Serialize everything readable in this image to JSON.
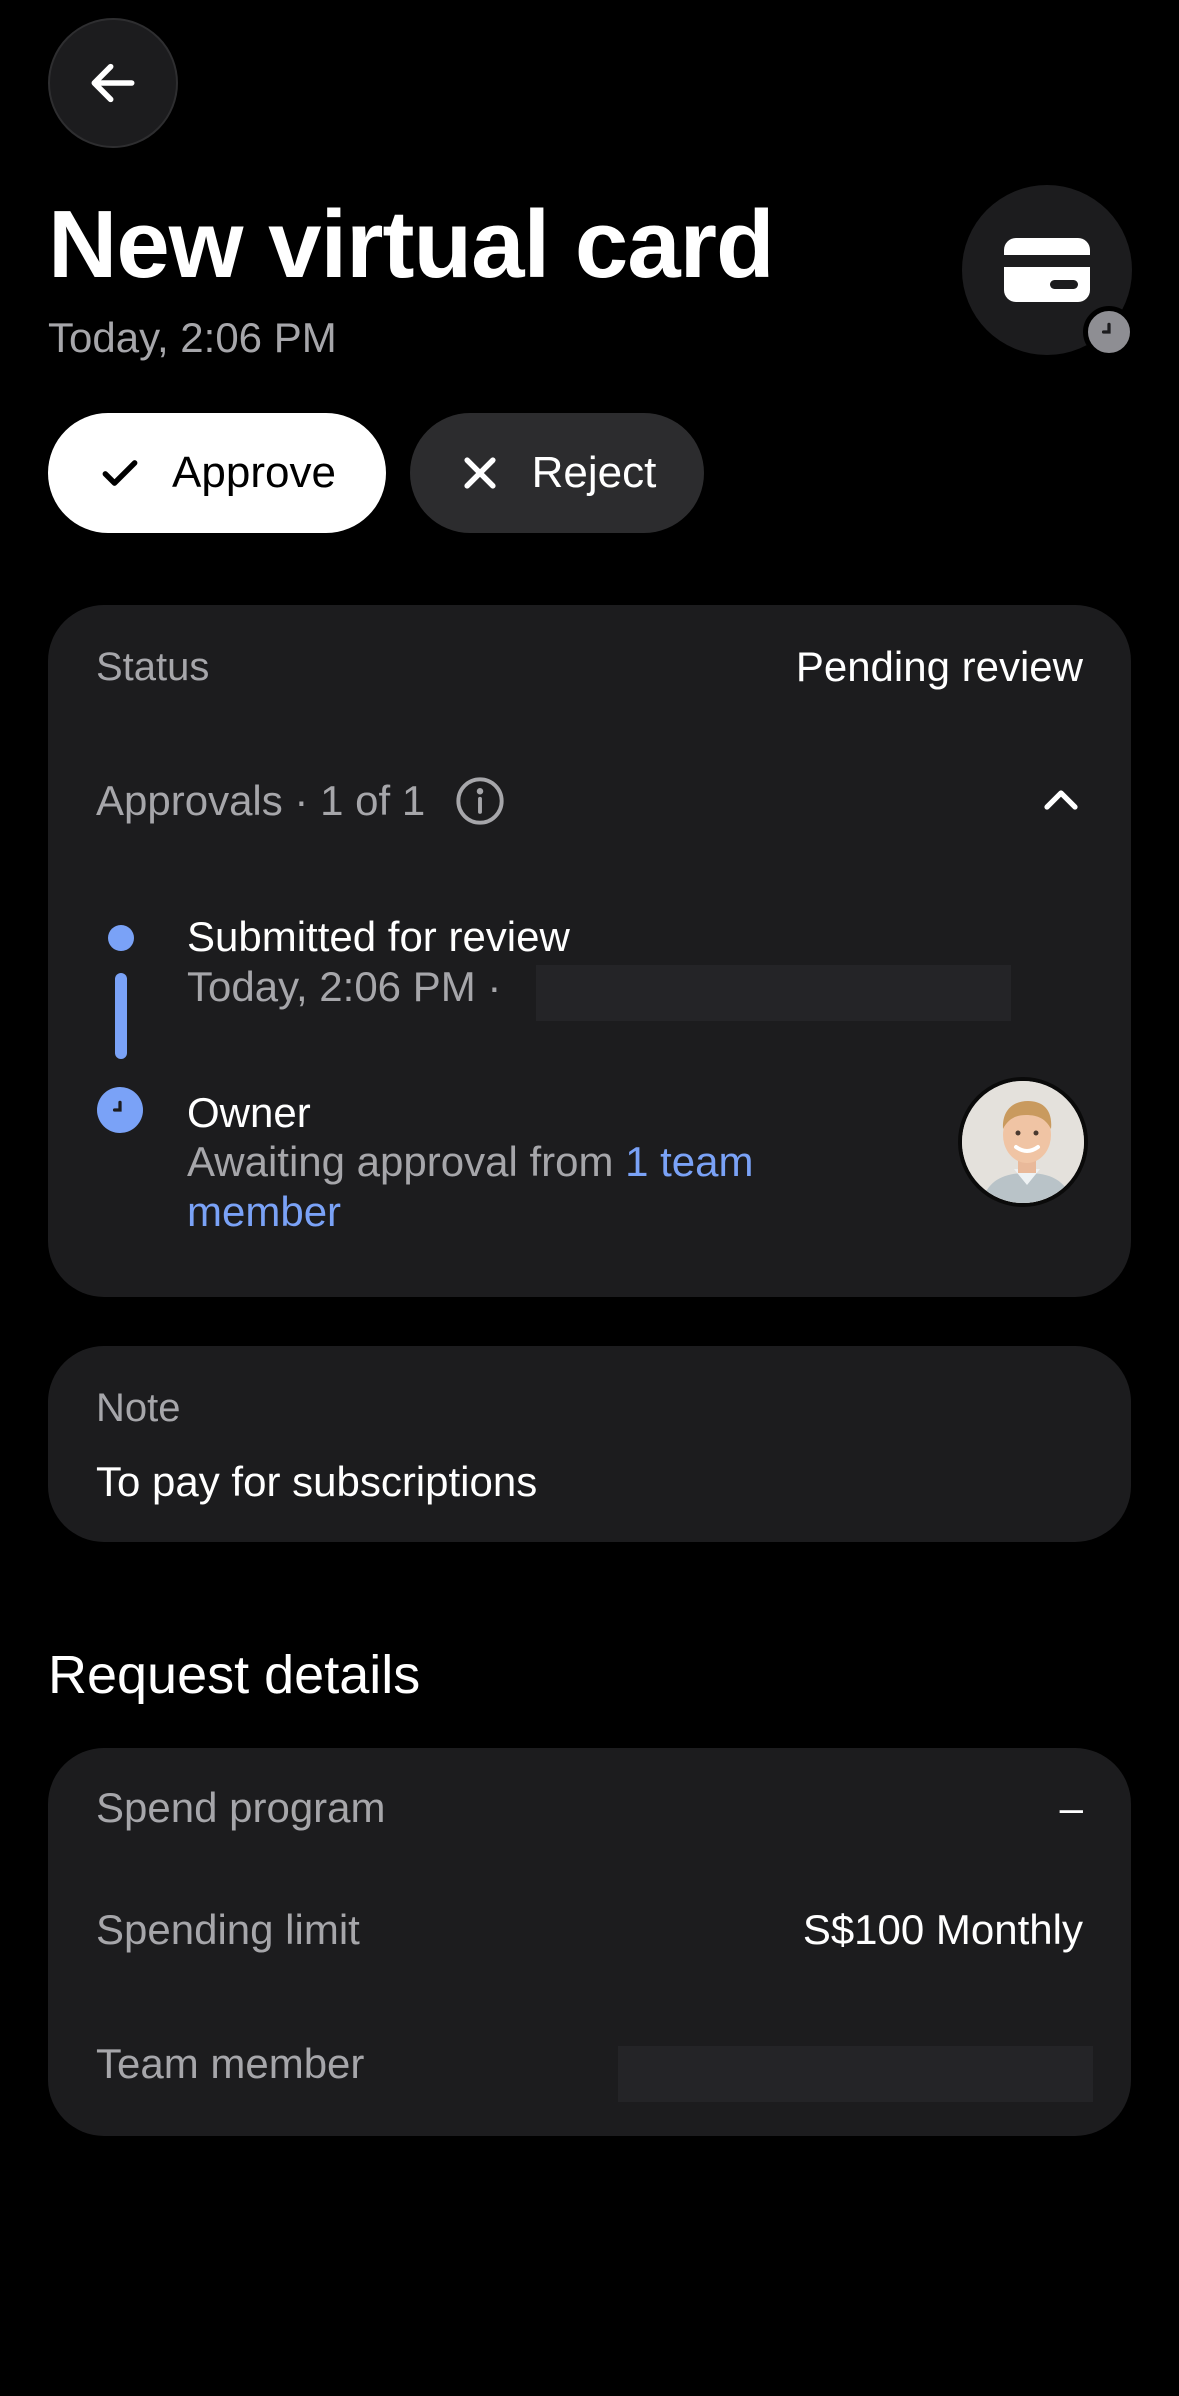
{
  "header": {
    "title": "New virtual card",
    "subtitle": "Today, 2:06 PM"
  },
  "icons": {
    "back": "arrow-left-icon",
    "card": "credit-card-icon",
    "badge": "clock-icon",
    "info": "info-icon",
    "collapse": "chevron-up-icon"
  },
  "actions": {
    "approve_label": "Approve",
    "reject_label": "Reject"
  },
  "status_panel": {
    "status_label": "Status",
    "status_value": "Pending review",
    "approvals_label": "Approvals · 1 of 1",
    "timeline": {
      "submitted_title": "Submitted for review",
      "submitted_meta": "Today, 2:06 PM ·",
      "owner_title": "Owner",
      "owner_text": "Awaiting approval from ",
      "owner_link": "1 team member"
    }
  },
  "note_panel": {
    "label": "Note",
    "text": "To pay for subscriptions"
  },
  "request_details": {
    "section_title": "Request details",
    "rows": [
      {
        "label": "Spend program",
        "value": "–"
      },
      {
        "label": "Spending limit",
        "value": "S$100 Monthly"
      },
      {
        "label": "Team member",
        "value": ""
      }
    ]
  },
  "colors": {
    "background": "#000000",
    "panel": "#1c1c1e",
    "accent": "#7aa2f7",
    "muted_text": "#a6a6aa"
  }
}
